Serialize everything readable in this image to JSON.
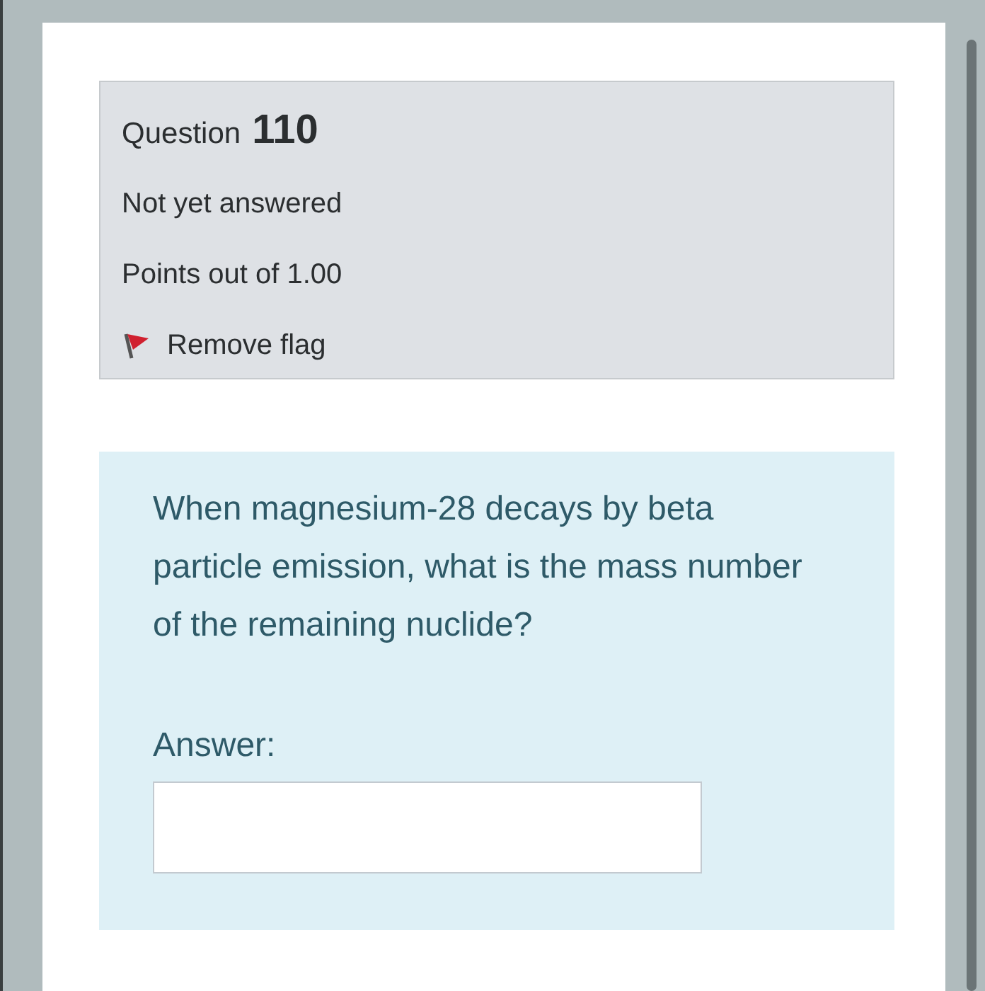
{
  "question_info": {
    "label": "Question",
    "number": "110",
    "status": "Not yet answered",
    "points": "Points out of 1.00",
    "flag": {
      "label": "Remove flag",
      "flagged": true
    }
  },
  "question": {
    "text": "When magnesium-28 decays by beta particle emission, what is the mass number of the remaining nuclide?",
    "answer_label": "Answer:"
  }
}
